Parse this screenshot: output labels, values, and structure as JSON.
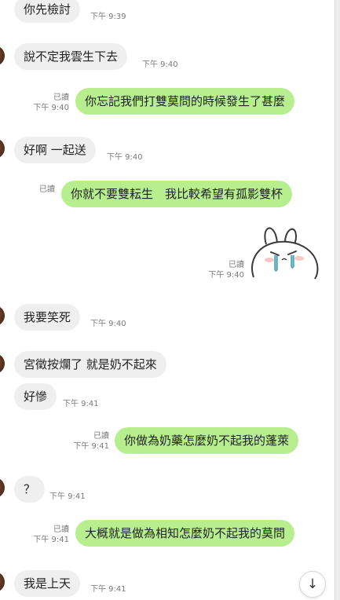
{
  "messages": [
    {
      "side": "in",
      "text": "你先檢討",
      "time": "下午 9:39"
    },
    {
      "side": "in",
      "text": "說不定我雲生下去",
      "time": "下午 9:40"
    },
    {
      "side": "out",
      "read": "已讀",
      "text": "你忘記我們打雙莫問的時候發生了甚麼",
      "time": "下午 9:40"
    },
    {
      "side": "in",
      "text": "好啊 一起送",
      "time": "下午 9:40"
    },
    {
      "side": "out",
      "read": "已讀",
      "text": "你就不要雙耘生　我比較希望有孤影雙杯",
      "time": ""
    },
    {
      "side": "out",
      "read": "已讀",
      "sticker": "crying-bunny-sticker",
      "time": "下午 9:40"
    },
    {
      "side": "in",
      "text": "我要笑死",
      "time": "下午 9:40"
    },
    {
      "side": "in",
      "text": "宮徵按爛了 就是奶不起來",
      "time": ""
    },
    {
      "side": "in",
      "text": "好慘",
      "time": "下午 9:41"
    },
    {
      "side": "out",
      "read": "已讀",
      "text": "你做為奶藥怎麼奶不起我的蓬萊",
      "time": "下午 9:41"
    },
    {
      "side": "in",
      "text": "？",
      "time": "下午 9:41"
    },
    {
      "side": "out",
      "read": "已讀",
      "text": "大概就是做為相知怎麼奶不起我的莫問",
      "time": "下午 9:41"
    },
    {
      "side": "in",
      "text": "我是上天",
      "time": "下午 9:41"
    }
  ],
  "scroll_button_icon": "↓",
  "colors": {
    "incoming_bubble": "#efefef",
    "outgoing_bubble": "#b7ef8f",
    "background": "#ffffff",
    "meta_text": "#7a7a7a"
  }
}
